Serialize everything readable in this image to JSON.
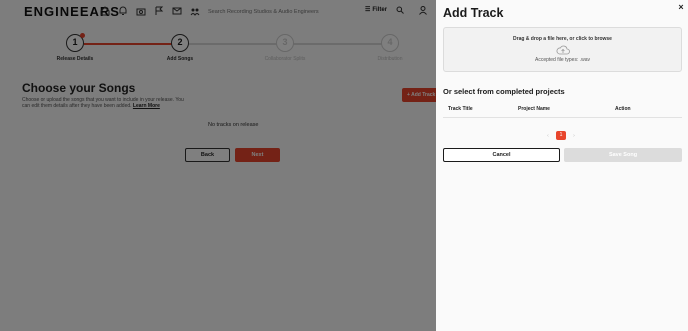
{
  "app": {
    "logo": "ENGINEEARS",
    "search_placeholder": "Search Recording Studios & Audio Engineers",
    "filter_label": "Filter",
    "nav_icons": [
      "home-icon",
      "bell-icon",
      "camera-icon",
      "flag-icon",
      "mail-icon",
      "community-icon"
    ],
    "steps": [
      {
        "number": "1",
        "label": "Release Details",
        "state": "complete"
      },
      {
        "number": "2",
        "label": "Add Songs",
        "state": "active"
      },
      {
        "number": "3",
        "label": "Collaborator Splits",
        "state": "inactive"
      },
      {
        "number": "4",
        "label": "Distribution",
        "state": "inactive"
      }
    ],
    "page_title": "Choose your Songs",
    "page_subtitle": "Choose or upload the songs that you want to include in your release. You can edit them details after they have been added.",
    "learn_more": "Learn More",
    "add_track_button": "+ Add Track",
    "empty_message": "No tracks on release",
    "back_button": "Back",
    "next_button": "Next"
  },
  "drawer": {
    "title": "Add Track",
    "close_label": "×",
    "dropzone_title": "Drag & drop a file here, or click to browse",
    "dropzone_types": "Accepted file types: .wav",
    "section_title": "Or select from completed projects",
    "columns": [
      "Track Title",
      "Project Name",
      "Action"
    ],
    "pagination": {
      "prev": "‹",
      "current": "1",
      "next": "›"
    },
    "cancel_button": "Cancel",
    "save_button": "Save Song"
  },
  "colors": {
    "accent": "#e8452c",
    "overlay": "#000000",
    "disabled": "#dcdcdc"
  }
}
